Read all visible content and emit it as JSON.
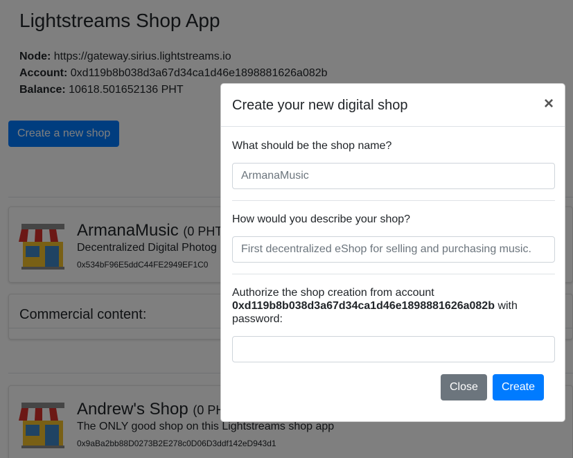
{
  "app": {
    "title": "Lightstreams Shop App",
    "node_label": "Node:",
    "node_value": "https://gateway.sirius.lightstreams.io",
    "account_label": "Account:",
    "account_value": "0xd119b8b038d3a67d34ca1d46e1898881626a082b",
    "balance_label": "Balance:",
    "balance_value": "10618.501652136 PHT",
    "create_button": "Create a new shop"
  },
  "shops": [
    {
      "name": "ArmanaMusic",
      "pht": "(0 PHT",
      "description": "Decentralized Digital Photog",
      "address": "0x534bF96E5ddC44FE2949EF1C0"
    },
    {
      "name": "Andrew's Shop",
      "pht": "(0 PH",
      "description": "The ONLY good shop on this Lightstreams shop app",
      "address": "0x9aBa2bb88D0273B2E278c0D06D3ddf142eD943d1"
    }
  ],
  "commercial": {
    "title": "Commercial content:"
  },
  "modal": {
    "title": "Create your new digital shop",
    "close_symbol": "×",
    "name_label": "What should be the shop name?",
    "name_placeholder": "ArmanaMusic",
    "desc_label": "How would you describe your shop?",
    "desc_placeholder": "First decentralized eShop for selling and purchasing music.",
    "auth_prefix": "Authorize the shop creation from account",
    "auth_account": "0xd119b8b038d3a67d34ca1d46e1898881626a082b",
    "auth_suffix": "with password:",
    "password_value": "",
    "close_button": "Close",
    "create_button": "Create"
  },
  "colors": {
    "primary": "#007bff",
    "secondary": "#6c757d",
    "awning_red": "#d9312b",
    "shop_blue": "#3f87c7",
    "shop_yellow": "#f3c02b"
  },
  "icons": {
    "shop": "shop-storefront-icon",
    "close": "close-icon"
  }
}
